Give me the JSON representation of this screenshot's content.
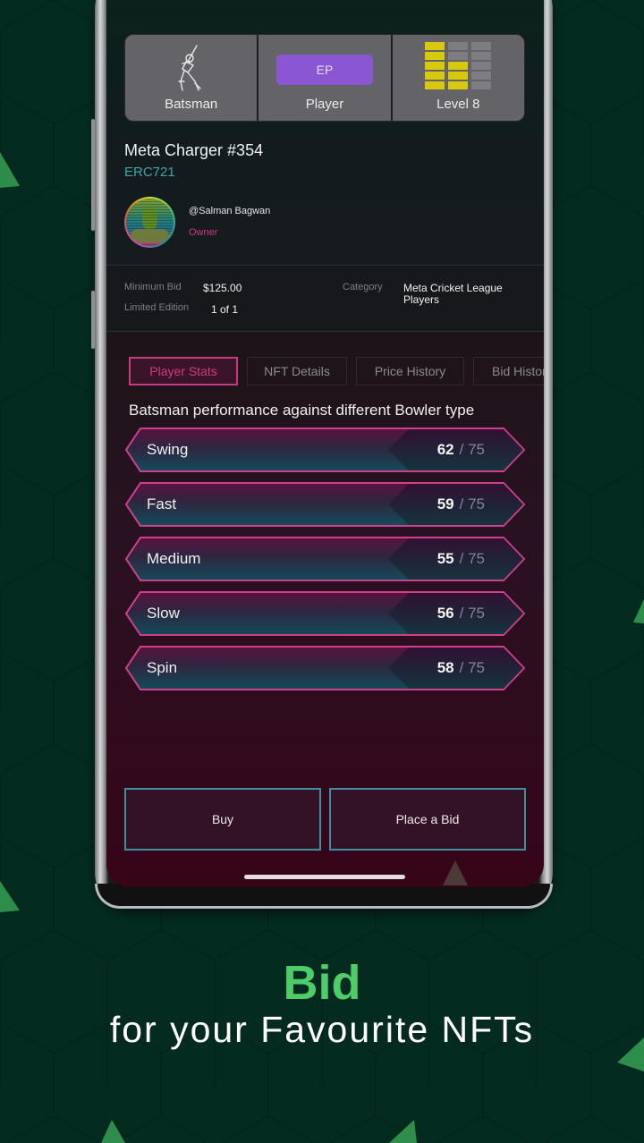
{
  "attributes": {
    "role": {
      "label": "Batsman",
      "icon": "batsman-icon"
    },
    "type": {
      "badge": "EP",
      "label": "Player",
      "badge_color": "#8a56d1"
    },
    "level": {
      "label": "Level 8",
      "value": 8,
      "max": 15,
      "columns_filled": [
        5,
        3,
        0
      ],
      "segments_per_column": 5,
      "on_color": "#d8c90c"
    }
  },
  "nft": {
    "title": "Meta Charger #354",
    "standard": "ERC721"
  },
  "owner": {
    "name": "@Salman Bagwan",
    "role": "Owner"
  },
  "info": {
    "minimum_bid_label": "Minimum Bid",
    "minimum_bid_value": "$125.00",
    "edition_label": "Limited Edition",
    "edition_value": "1 of 1",
    "category_label": "Category",
    "category_value_line1": "Meta Cricket League",
    "category_value_line2": "Players"
  },
  "tabs": [
    {
      "label": "Player Stats",
      "active": true
    },
    {
      "label": "NFT Details",
      "active": false
    },
    {
      "label": "Price History",
      "active": false
    },
    {
      "label": "Bid History",
      "active": false
    }
  ],
  "stats": {
    "title": "Batsman performance against different Bowler type",
    "max": 75,
    "max_label": "/ 75",
    "rows": [
      {
        "name": "Swing",
        "value": 62
      },
      {
        "name": "Fast",
        "value": 59
      },
      {
        "name": "Medium",
        "value": 55
      },
      {
        "name": "Slow",
        "value": 56
      },
      {
        "name": "Spin",
        "value": 58
      }
    ]
  },
  "actions": {
    "buy_label": "Buy",
    "bid_label": "Place a Bid"
  },
  "promo": {
    "title": "Bid",
    "subtitle": "for your Favourite NFTs",
    "title_color": "#4dcc6a"
  }
}
